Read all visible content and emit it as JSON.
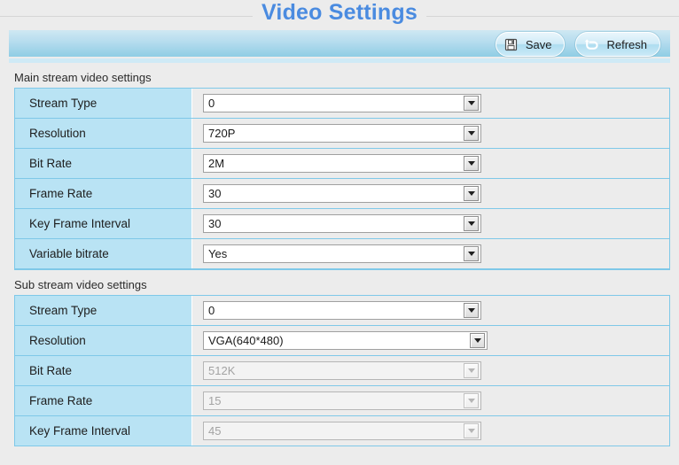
{
  "page": {
    "title": "Video Settings"
  },
  "toolbar": {
    "save_label": "Save",
    "refresh_label": "Refresh",
    "save_icon": "floppy-disk-icon",
    "refresh_icon": "undo-arrow-icon"
  },
  "sections": [
    {
      "caption": "Main stream video settings",
      "rows": [
        {
          "label": "Stream Type",
          "value": "0",
          "disabled": false
        },
        {
          "label": "Resolution",
          "value": "720P",
          "disabled": false
        },
        {
          "label": "Bit Rate",
          "value": "2M",
          "disabled": false
        },
        {
          "label": "Frame Rate",
          "value": "30",
          "disabled": false
        },
        {
          "label": "Key Frame Interval",
          "value": "30",
          "disabled": false
        },
        {
          "label": "Variable bitrate",
          "value": "Yes",
          "disabled": false
        }
      ]
    },
    {
      "caption": "Sub stream video settings",
      "rows": [
        {
          "label": "Stream Type",
          "value": "0",
          "disabled": false
        },
        {
          "label": "Resolution",
          "value": "VGA(640*480)",
          "disabled": false
        },
        {
          "label": "Bit Rate",
          "value": "512K",
          "disabled": true
        },
        {
          "label": "Frame Rate",
          "value": "15",
          "disabled": true
        },
        {
          "label": "Key Frame Interval",
          "value": "45",
          "disabled": true
        }
      ]
    }
  ],
  "colors": {
    "title": "#4a8be0",
    "label_cell": "#b9e3f4",
    "table_border": "#7fc8e8",
    "page_bg": "#ececec",
    "toolbar_top": "#cfe8f3",
    "toolbar_bottom": "#8fcde4"
  }
}
